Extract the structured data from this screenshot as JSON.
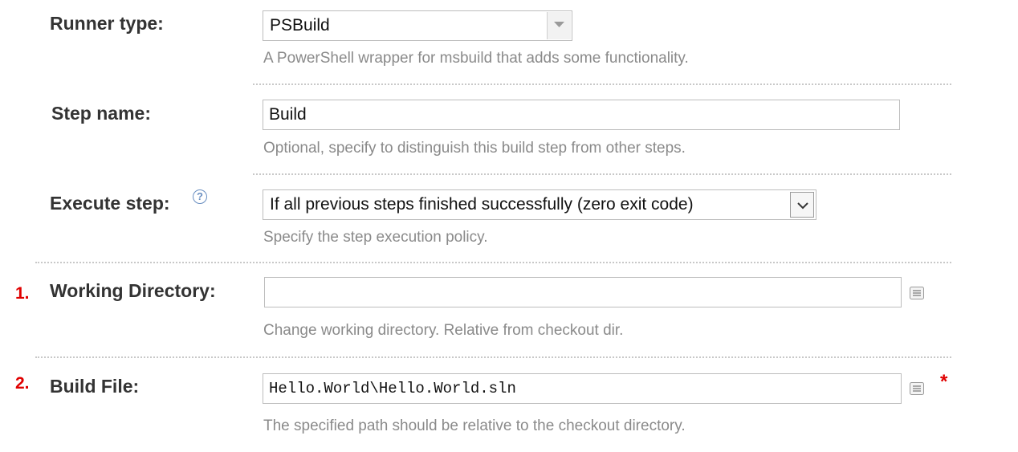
{
  "runner_type": {
    "label": "Runner type:",
    "value": "PSBuild",
    "hint": "A PowerShell wrapper for msbuild that adds some functionality."
  },
  "step_name": {
    "label": "Step name:",
    "value": "Build",
    "hint": "Optional, specify to distinguish this build step from other steps."
  },
  "execute_step": {
    "label": "Execute step:",
    "help_icon": "question-circle-icon",
    "value": "If all previous steps finished successfully (zero exit code)",
    "hint": "Specify the step execution policy."
  },
  "working_directory": {
    "marker": "1.",
    "label": "Working Directory:",
    "value": "",
    "hint": "Change working directory. Relative from checkout dir.",
    "icon": "list-icon"
  },
  "build_file": {
    "marker": "2.",
    "label": "Build File:",
    "value": "Hello.World\\Hello.World.sln",
    "hint": "The specified path should be relative to the checkout directory.",
    "icon": "list-icon",
    "required_mark": "*"
  },
  "colors": {
    "marker": "#e00000",
    "hint_text": "#8a8a8a",
    "help_icon": "#6a8fc1"
  }
}
